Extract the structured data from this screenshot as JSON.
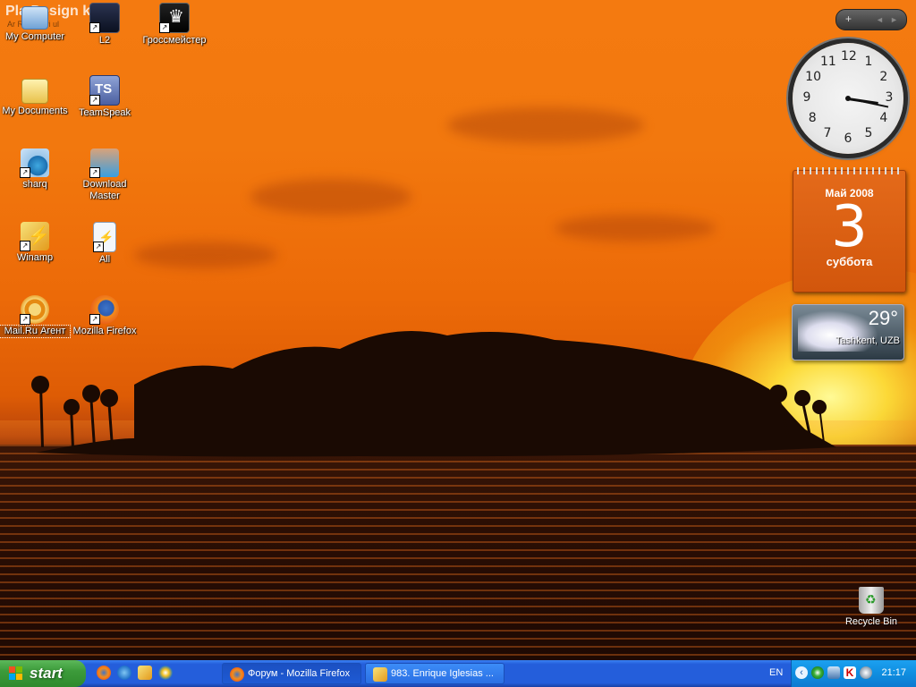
{
  "desktop": {
    "watermark": "Pla Design k",
    "watermark_sub": "Ar Rob Davi ul",
    "icons": [
      {
        "label": "My Computer",
        "icon": "my-computer-icon",
        "shortcut": false
      },
      {
        "label": "L2",
        "icon": "lineage2-icon",
        "shortcut": true
      },
      {
        "label": "Гроссмейстер",
        "icon": "chess-icon",
        "shortcut": true
      },
      {
        "label": "My Documents",
        "icon": "my-documents-icon",
        "shortcut": false
      },
      {
        "label": "TeamSpeak",
        "icon": "teamspeak-icon",
        "shortcut": true
      },
      {
        "label": "sharq",
        "icon": "network-globe-icon",
        "shortcut": true
      },
      {
        "label": "Download Master",
        "icon": "download-master-icon",
        "shortcut": true
      },
      {
        "label": "Winamp",
        "icon": "winamp-icon",
        "shortcut": true
      },
      {
        "label": "All",
        "icon": "text-file-icon",
        "shortcut": true
      },
      {
        "label": "Mail.Ru Агент",
        "icon": "mailru-agent-icon",
        "shortcut": true
      },
      {
        "label": "Mozilla Firefox",
        "icon": "firefox-icon",
        "shortcut": true
      }
    ],
    "recycle_bin": "Recycle Bin"
  },
  "gadgets": {
    "controls": {
      "add": "+",
      "prev": "◄",
      "next": "►"
    },
    "clock": {
      "hours": 3,
      "minutes": 17,
      "numbers": [
        "12",
        "1",
        "2",
        "3",
        "4",
        "5",
        "6",
        "7",
        "8",
        "9",
        "10",
        "11"
      ]
    },
    "calendar": {
      "month": "Май 2008",
      "day": "3",
      "weekday": "суббота"
    },
    "weather": {
      "temperature": "29°",
      "city": "Tashkent, UZB"
    }
  },
  "taskbar": {
    "start_label": "start",
    "quick_launch": [
      "firefox-icon",
      "ie-icon",
      "winamp-icon",
      "media-player-icon"
    ],
    "tasks": [
      {
        "label": "Форум - Mozilla Firefox",
        "icon": "firefox-icon",
        "active": true
      },
      {
        "label": "983. Enrique Iglesias ...",
        "icon": "winamp-icon",
        "active": false
      }
    ],
    "language": "EN",
    "tray_icons": [
      "show-hidden-icon",
      "mailru-icon",
      "network-icon",
      "kaspersky-icon",
      "speaker-icon"
    ],
    "time": "21:17"
  },
  "colors": {
    "sky": "#f2780e",
    "taskbar": "#245edb",
    "start": "#3c9b3a",
    "tray": "#0f8ee0"
  }
}
